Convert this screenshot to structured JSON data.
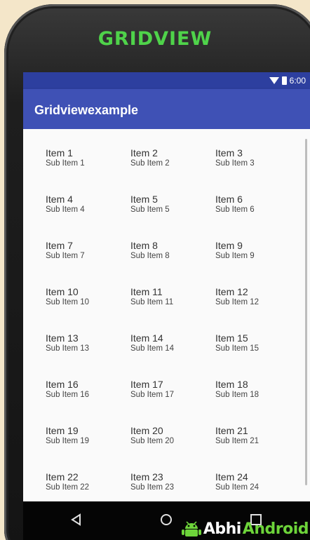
{
  "device": {
    "brand_label": "GRIDVIEW"
  },
  "status_bar": {
    "time": "6:00",
    "wifi_icon": "wifi-icon",
    "battery_icon": "battery-icon"
  },
  "app_bar": {
    "title": "Gridviewexample"
  },
  "grid": {
    "items": [
      {
        "title": "Item 1",
        "sub": "Sub Item 1"
      },
      {
        "title": "Item 2",
        "sub": "Sub Item 2"
      },
      {
        "title": "Item 3",
        "sub": "Sub Item 3"
      },
      {
        "title": "Item 4",
        "sub": "Sub Item 4"
      },
      {
        "title": "Item 5",
        "sub": "Sub Item 5"
      },
      {
        "title": "Item 6",
        "sub": "Sub Item 6"
      },
      {
        "title": "Item 7",
        "sub": "Sub Item 7"
      },
      {
        "title": "Item 8",
        "sub": "Sub Item 8"
      },
      {
        "title": "Item 9",
        "sub": "Sub Item 9"
      },
      {
        "title": "Item 10",
        "sub": "Sub Item 10"
      },
      {
        "title": "Item 11",
        "sub": "Sub Item 11"
      },
      {
        "title": "Item 12",
        "sub": "Sub Item 12"
      },
      {
        "title": "Item 13",
        "sub": "Sub Item 13"
      },
      {
        "title": "Item 14",
        "sub": "Sub Item 14"
      },
      {
        "title": "Item 15",
        "sub": "Sub Item 15"
      },
      {
        "title": "Item 16",
        "sub": "Sub Item 16"
      },
      {
        "title": "Item 17",
        "sub": "Sub Item 17"
      },
      {
        "title": "Item 18",
        "sub": "Sub Item 18"
      },
      {
        "title": "Item 19",
        "sub": "Sub Item 19"
      },
      {
        "title": "Item 20",
        "sub": "Sub Item 20"
      },
      {
        "title": "Item 21",
        "sub": "Sub Item 21"
      },
      {
        "title": "Item 22",
        "sub": "Sub Item 22"
      },
      {
        "title": "Item 23",
        "sub": "Sub Item 23"
      },
      {
        "title": "Item 24",
        "sub": "Sub Item 24"
      }
    ]
  },
  "nav_bar": {
    "back_icon": "back-triangle-icon",
    "home_icon": "home-circle-icon",
    "recent_icon": "recent-apps-square-icon"
  },
  "watermark": {
    "part1": "Abhi",
    "part2": "Android"
  },
  "colors": {
    "app_bar": "#3f51b5",
    "status_bar": "#2d3f9f",
    "brand_green": "#4fd34a"
  }
}
